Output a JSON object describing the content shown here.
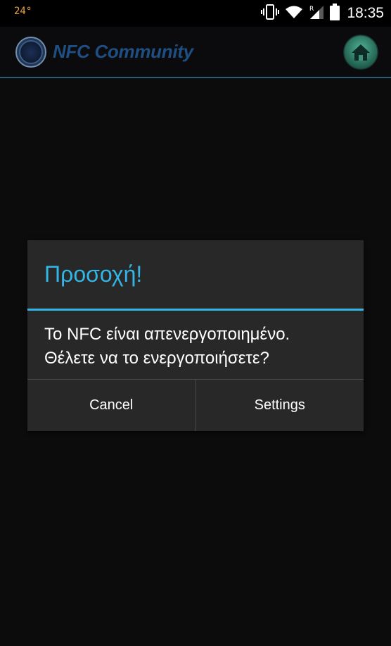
{
  "status_bar": {
    "temperature": "24°",
    "time": "18:35",
    "icons": [
      "vibrate-icon",
      "wifi-icon",
      "signal-icon",
      "battery-icon"
    ],
    "signal_badge": "R"
  },
  "action_bar": {
    "title": "NFC Community",
    "logo_icon": "nfc-ring-icon",
    "home_icon": "home-icon"
  },
  "dialog": {
    "title": "Προσοχή!",
    "message_line1": "Το NFC είναι απενεργοποιημένο.",
    "message_line2": "Θέλετε να το ενεργοποιήσετε?",
    "buttons": {
      "cancel": "Cancel",
      "settings": "Settings"
    }
  },
  "colors": {
    "accent": "#33b5e5",
    "title_blue": "#1f4f82",
    "temperature": "#e8a33a",
    "dialog_bg": "#282828",
    "screen_bg": "#0c0c0d",
    "home_green": "#2e7d6b"
  }
}
